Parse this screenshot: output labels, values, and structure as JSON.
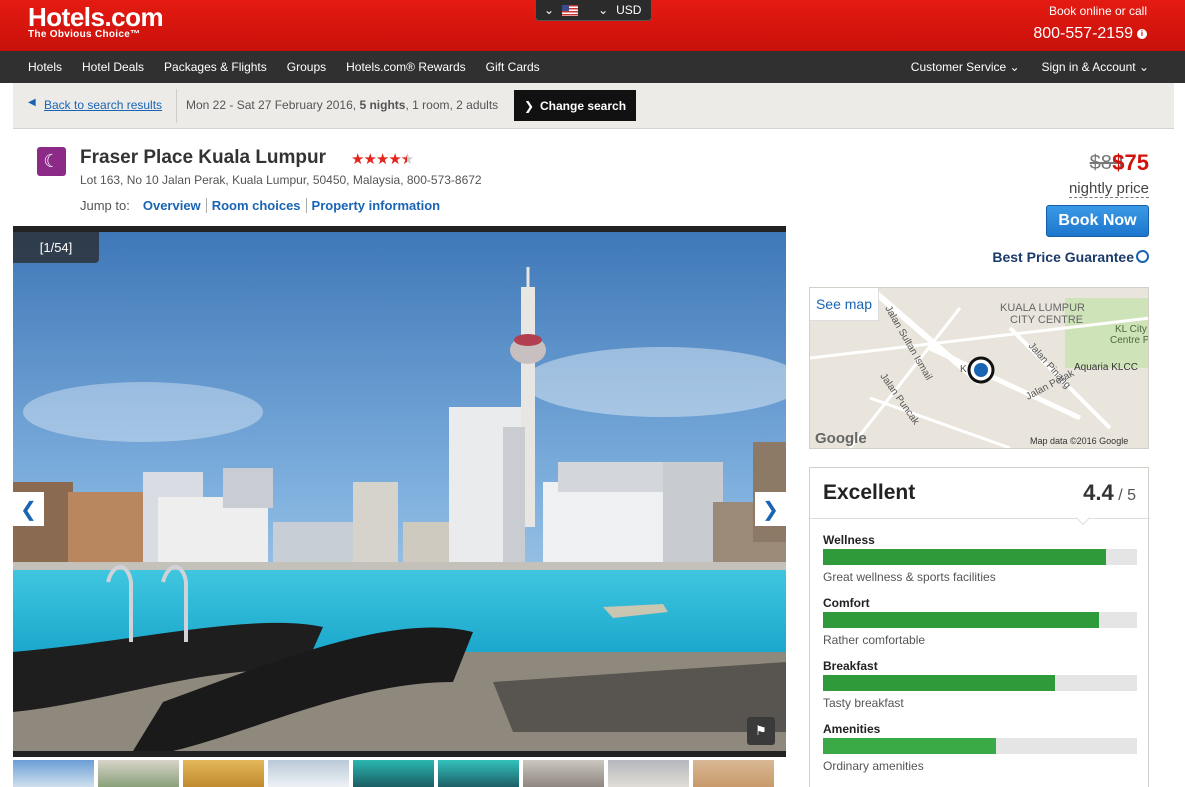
{
  "header": {
    "logo": "Hotels.com",
    "tagline": "The Obvious Choice™",
    "currency": "USD",
    "book_label": "Book online or call",
    "phone": "800-557-2159"
  },
  "nav": {
    "left": [
      "Hotels",
      "Hotel Deals",
      "Packages & Flights",
      "Groups",
      "Hotels.com® Rewards",
      "Gift Cards"
    ],
    "customer_service": "Customer Service ⌄",
    "sign_in": "Sign in & Account ⌄"
  },
  "search": {
    "back": "Back to search results",
    "dates": "Mon 22 - Sat 27 February 2016,",
    "nights": "5 nights",
    "occupancy": ", 1 room, 2 adults",
    "change": "Change search"
  },
  "hotel": {
    "name": "Fraser Place Kuala Lumpur",
    "stars": 4.5,
    "address": "Lot 163, No 10 Jalan Perak, Kuala Lumpur, 50450, Malaysia, 800-573-8672",
    "jump_to": "Jump to:",
    "jump_links": [
      "Overview",
      "Room choices",
      "Property information"
    ]
  },
  "pricing": {
    "old_price": "$89",
    "new_price": "$75",
    "nightly": "nightly price",
    "book_now": "Book Now",
    "guarantee": "Best Price Guarantee"
  },
  "gallery": {
    "counter": "[1/54]"
  },
  "map": {
    "see_map": "See map",
    "labels": [
      "KUALA LUMPUR",
      "CITY CENTRE",
      "KL City",
      "Centre Par",
      "Aquaria KLCC",
      "Jalan Sultan Ismail",
      "Jalan Pinang",
      "Jalan Perak",
      "Jalan Puncak",
      "K"
    ],
    "google": "Google",
    "attribution": "Map data ©2016 Google"
  },
  "ratings": {
    "title": "Excellent",
    "score": "4.4",
    "out_of": " / 5",
    "categories": [
      {
        "label": "Wellness",
        "score": 0.9,
        "desc": "Great wellness & sports facilities",
        "color": "#2e9a3a"
      },
      {
        "label": "Comfort",
        "score": 0.88,
        "desc": "Rather comfortable",
        "color": "#2e9a3a"
      },
      {
        "label": "Breakfast",
        "score": 0.74,
        "desc": "Tasty breakfast",
        "color": "#2e9a3a"
      },
      {
        "label": "Amenities",
        "score": 0.55,
        "desc": "Ordinary amenities",
        "color": "#3aaa46"
      }
    ]
  },
  "colors": {
    "brand_red": "#d0140c",
    "link_blue": "#1a64b4"
  }
}
